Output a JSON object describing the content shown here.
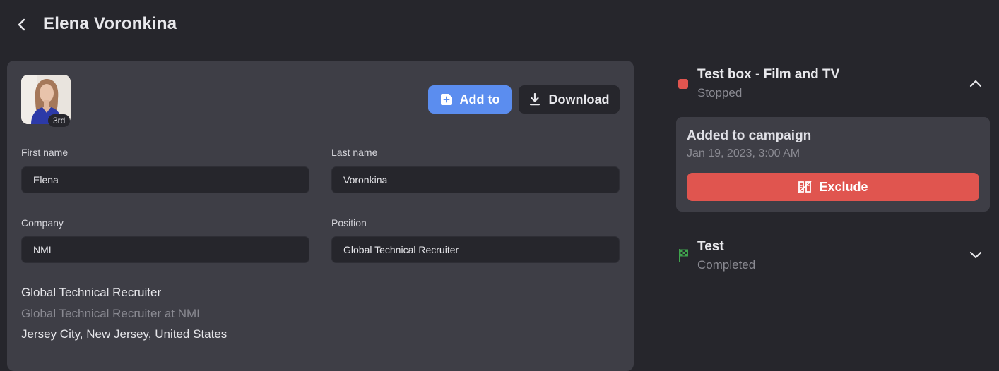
{
  "header": {
    "title": "Elena Voronkina"
  },
  "profile": {
    "degree_badge": "3rd",
    "add_to_label": "Add to",
    "download_label": "Download",
    "fields": {
      "first_name_label": "First name",
      "first_name_value": "Elena",
      "last_name_label": "Last name",
      "last_name_value": "Voronkina",
      "company_label": "Company",
      "company_value": "NMI",
      "position_label": "Position",
      "position_value": "Global Technical Recruiter"
    },
    "headline": "Global Technical Recruiter",
    "headline_company": "Global Technical Recruiter at NMI",
    "location": "Jersey City, New Jersey, United States"
  },
  "campaigns": [
    {
      "title": "Test box - Film and TV",
      "status": "Stopped",
      "status_color": "#e0554f",
      "expanded": true,
      "details": {
        "event": "Added to campaign",
        "date": "Jan 19, 2023, 3:00 AM",
        "exclude_label": "Exclude"
      }
    },
    {
      "title": "Test",
      "status": "Completed",
      "status_color": "#3fa34d",
      "expanded": false
    }
  ],
  "colors": {
    "background": "#26262c",
    "card": "#3e3e46",
    "accent_blue": "#5b8def",
    "danger_red": "#e0554f",
    "success_green": "#3fa34d"
  },
  "icons": [
    "back-arrow-icon",
    "add-to-icon",
    "download-icon",
    "chevron-up-icon",
    "exclude-icon",
    "finish-flag-icon",
    "chevron-down-icon"
  ]
}
